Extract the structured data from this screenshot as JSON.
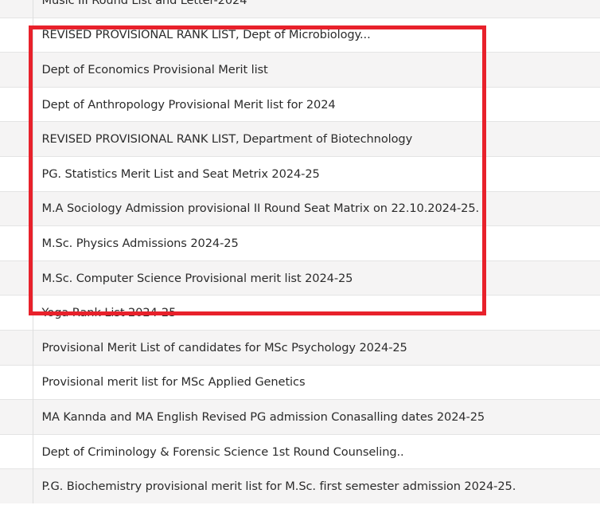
{
  "list": {
    "items": [
      {
        "title": "Music III Round List and Letter-2024"
      },
      {
        "title": "REVISED PROVISIONAL RANK LIST, Dept of Microbiology..."
      },
      {
        "title": "Dept of Economics Provisional Merit list"
      },
      {
        "title": "Dept of Anthropology Provisional Merit list for 2024"
      },
      {
        "title": "REVISED PROVISIONAL RANK LIST, Department of Biotechnology"
      },
      {
        "title": "PG. Statistics Merit List and Seat Metrix 2024-25"
      },
      {
        "title": "M.A Sociology Admission provisional II Round Seat Matrix on 22.10.2024-25."
      },
      {
        "title": "M.Sc. Physics Admissions 2024-25"
      },
      {
        "title": "M.Sc. Computer Science Provisional merit list 2024-25"
      },
      {
        "title": "Yoga Rank List 2024-25"
      },
      {
        "title": "Provisional Merit List of candidates for MSc Psychology 2024-25"
      },
      {
        "title": "Provisional merit list for MSc Applied Genetics"
      },
      {
        "title": "MA Kannda and MA English Revised PG admission Conasalling dates 2024-25"
      },
      {
        "title": "Dept of Criminology & Forensic Science 1st Round Counseling.."
      },
      {
        "title": "P.G. Biochemistry provisional merit list for M.Sc. first semester admission 2024-25."
      }
    ]
  },
  "colors": {
    "highlight_border": "#e8212b",
    "row_alt": "#f5f4f4",
    "row": "#ffffff",
    "text": "#2b2b2b"
  }
}
